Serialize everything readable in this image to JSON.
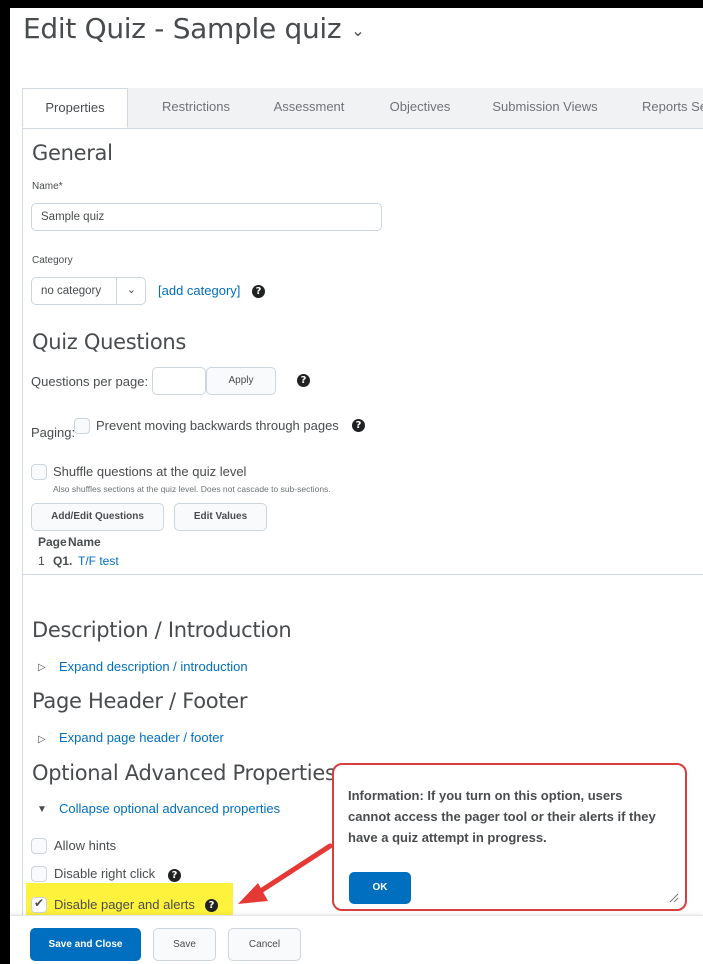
{
  "header": {
    "title": "Edit Quiz - Sample quiz",
    "title_chevron": "⌄"
  },
  "tabs": [
    {
      "label": "Properties",
      "active": true
    },
    {
      "label": "Restrictions"
    },
    {
      "label": "Assessment"
    },
    {
      "label": "Objectives"
    },
    {
      "label": "Submission Views"
    },
    {
      "label": "Reports Setu"
    }
  ],
  "general": {
    "heading": "General",
    "name_label": "Name",
    "name_required_mark": "*",
    "name_value": "Sample quiz",
    "category_label": "Category",
    "category_value": "no category",
    "add_category_link": "[add category]"
  },
  "quiz_questions": {
    "heading": "Quiz Questions",
    "per_page_label": "Questions per page:",
    "per_page_value": "",
    "apply_label": "Apply",
    "paging_label": "Paging:",
    "prevent_back_label": "Prevent moving backwards through pages",
    "shuffle_label": "Shuffle questions at the quiz level",
    "shuffle_note": "Also shuffles sections at the quiz level. Does not cascade to sub-sections.",
    "add_edit_label": "Add/Edit Questions",
    "edit_values_label": "Edit Values",
    "col_page": "Page",
    "col_name": "Name",
    "rows": [
      {
        "page": "1",
        "number": "Q1.",
        "name": "T/F test"
      }
    ]
  },
  "description": {
    "heading": "Description / Introduction",
    "expand_link": "Expand description / introduction"
  },
  "header_footer": {
    "heading": "Page Header / Footer",
    "expand_link": "Expand page header / footer"
  },
  "advanced": {
    "heading": "Optional Advanced Properties",
    "collapse_link": "Collapse optional advanced properties",
    "allow_hints": "Allow hints",
    "disable_right_click": "Disable right click",
    "disable_pager": "Disable pager and alerts"
  },
  "info_popup": {
    "text": "Information: If you turn on this option, users cannot access the pager tool or their alerts if they have a quiz attempt in progress.",
    "ok_label": "OK"
  },
  "footer": {
    "save_close": "Save and Close",
    "save": "Save",
    "cancel": "Cancel"
  },
  "icons": {
    "help": "?",
    "expand": "▷",
    "collapse": "▼",
    "check": "✔",
    "select_chevron": "⌄"
  },
  "colors": {
    "link": "#006fbf",
    "primary": "#006fbf",
    "highlight": "#fff23c",
    "callout": "#d93d3d"
  }
}
